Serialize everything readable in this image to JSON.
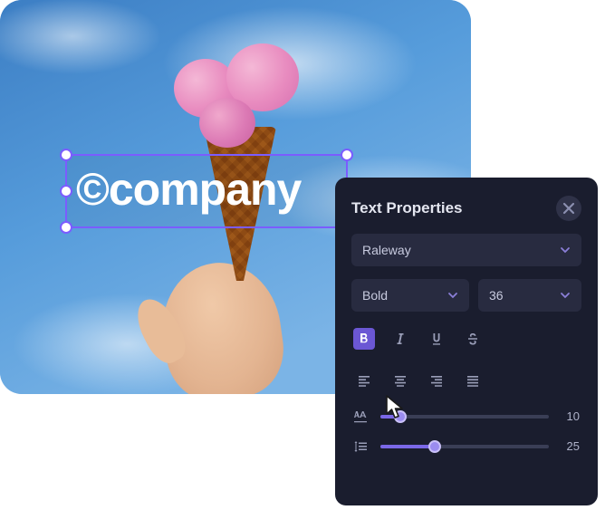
{
  "canvas": {
    "watermark_text": "©company"
  },
  "panel": {
    "title": "Text Properties",
    "font_family": "Raleway",
    "font_weight": "Bold",
    "font_size": "36",
    "letter_spacing": "10",
    "line_height": "25",
    "letter_spacing_pct": 12,
    "line_height_pct": 32
  },
  "colors": {
    "accent": "#7b68e8",
    "panel_bg": "#1a1d2e"
  },
  "icons": {
    "close": "close-icon",
    "chevron": "chevron-down-icon",
    "bold": "bold-icon",
    "italic": "italic-icon",
    "underline": "underline-icon",
    "strike": "strikethrough-icon",
    "align_left": "align-left-icon",
    "align_center": "align-center-icon",
    "align_right": "align-right-icon",
    "align_justify": "align-justify-icon",
    "letter_spacing": "letter-spacing-icon",
    "line_height": "line-height-icon"
  }
}
